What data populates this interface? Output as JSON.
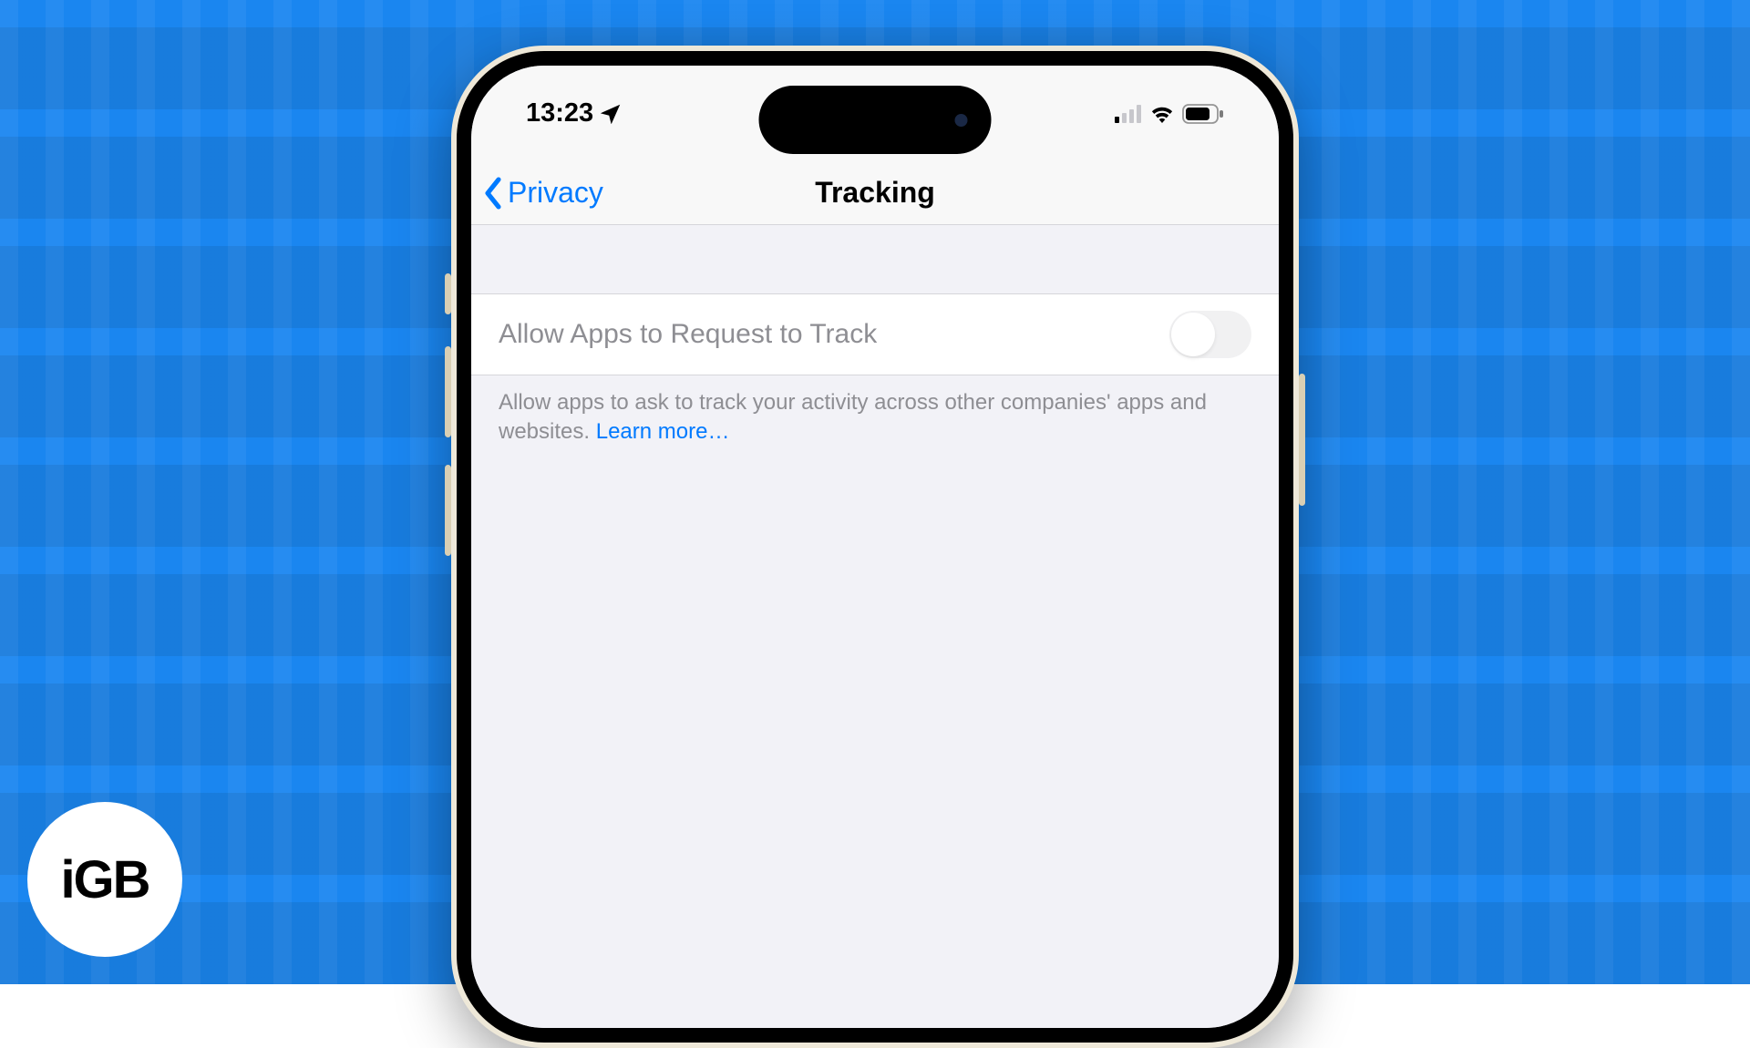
{
  "status": {
    "time": "13:23",
    "cellular_bars": 1,
    "wifi": true,
    "battery_pct": 75
  },
  "navbar": {
    "back_label": "Privacy",
    "title": "Tracking"
  },
  "setting": {
    "label": "Allow Apps to Request to Track",
    "enabled": false,
    "disabled": true
  },
  "footer": {
    "text": "Allow apps to ask to track your activity across other companies' apps and websites. ",
    "link": "Learn more…"
  },
  "badge": {
    "text": "iGB"
  }
}
